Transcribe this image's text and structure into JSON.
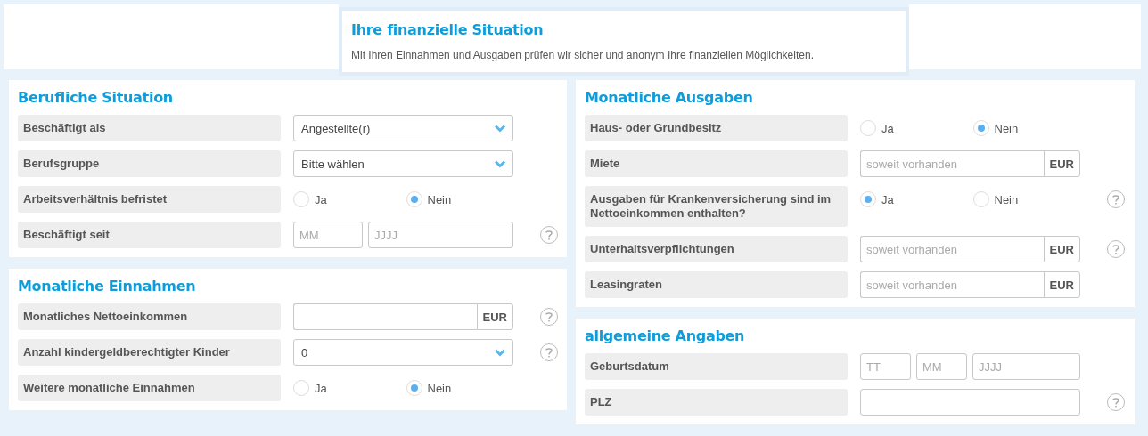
{
  "intro": {
    "title": "Ihre finanzielle Situation",
    "text": "Mit Ihren Einnahmen und Ausgaben prüfen wir sicher und anonym Ihre finanziellen Möglichkeiten."
  },
  "columns": [
    {
      "sections": [
        {
          "title": "Berufliche Situation",
          "rows": [
            {
              "label": "Beschäftigt als",
              "kind": "select",
              "value": "Angestellte(r)",
              "help": false
            },
            {
              "label": "Berufsgruppe",
              "kind": "select",
              "value": "Bitte wählen",
              "help": false
            },
            {
              "label": "Arbeitsverhältnis befristet",
              "kind": "radio",
              "options": [
                {
                  "label": "Ja",
                  "selected": false
                },
                {
                  "label": "Nein",
                  "selected": true
                }
              ],
              "help": false
            },
            {
              "label": "Beschäftigt seit",
              "kind": "date",
              "fields": [
                {
                  "placeholder": "MM"
                },
                {
                  "placeholder": "JJJJ"
                }
              ],
              "help": true
            }
          ]
        },
        {
          "title": "Monatliche Einnahmen",
          "rows": [
            {
              "label": "Monatliches Nettoeinkommen",
              "kind": "amount",
              "unit": "EUR",
              "help": true
            },
            {
              "label": "Anzahl kindergeldberechtigter Kinder",
              "kind": "select",
              "value": "0",
              "help": true
            },
            {
              "label": "Weitere monatliche Einnahmen",
              "kind": "radio",
              "options": [
                {
                  "label": "Ja",
                  "selected": false
                },
                {
                  "label": "Nein",
                  "selected": true
                }
              ],
              "help": false
            }
          ]
        }
      ]
    },
    {
      "sections": [
        {
          "title": "Monatliche Ausgaben",
          "rows": [
            {
              "label": "Haus- oder Grundbesitz",
              "kind": "radio",
              "options": [
                {
                  "label": "Ja",
                  "selected": false
                },
                {
                  "label": "Nein",
                  "selected": true
                }
              ],
              "help": false
            },
            {
              "label": "Miete",
              "kind": "amount",
              "placeholder": "soweit vorhanden",
              "unit": "EUR",
              "help": false
            },
            {
              "label": "Ausgaben für Krankenversicherung sind im Nettoeinkommen enthalten?",
              "kind": "radio",
              "options": [
                {
                  "label": "Ja",
                  "selected": true
                },
                {
                  "label": "Nein",
                  "selected": false
                }
              ],
              "help": true
            },
            {
              "label": "Unterhaltsverpflichtungen",
              "kind": "amount",
              "placeholder": "soweit vorhanden",
              "unit": "EUR",
              "help": true
            },
            {
              "label": "Leasingraten",
              "kind": "amount",
              "placeholder": "soweit vorhanden",
              "unit": "EUR",
              "help": false
            }
          ]
        },
        {
          "title": "allgemeine Angaben",
          "rows": [
            {
              "label": "Geburtsdatum",
              "kind": "date",
              "fields": [
                {
                  "placeholder": "TT"
                },
                {
                  "placeholder": "MM"
                },
                {
                  "placeholder": "JJJJ"
                }
              ],
              "help": false
            },
            {
              "label": "PLZ",
              "kind": "text",
              "help": true
            }
          ]
        }
      ]
    }
  ]
}
